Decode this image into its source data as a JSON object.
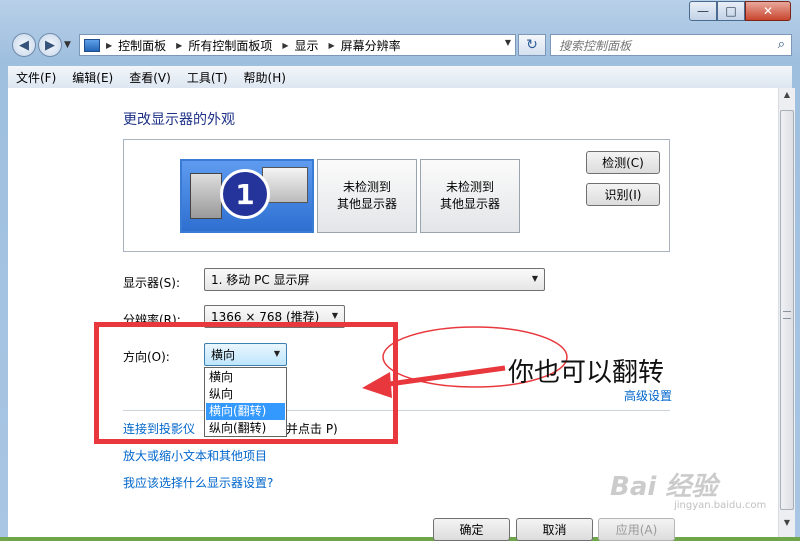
{
  "window": {
    "minimize_glyph": "—",
    "maximize_glyph": "□",
    "close_glyph": "✕"
  },
  "nav": {
    "back_glyph": "◀",
    "forward_glyph": "▶",
    "recent_glyph": "▼",
    "breadcrumbs": [
      "控制面板",
      "所有控制面板项",
      "显示",
      "屏幕分辨率"
    ],
    "refresh_glyph": "↻",
    "search_placeholder": "搜索控制面板",
    "search_glyph": "⌕"
  },
  "menu": [
    "文件(F)",
    "编辑(E)",
    "查看(V)",
    "工具(T)",
    "帮助(H)"
  ],
  "main": {
    "title": "更改显示器的外观",
    "monitors": [
      {
        "label": "1",
        "selected": true
      },
      {
        "label": "未检测到\n其他显示器"
      },
      {
        "label": "未检测到\n其他显示器"
      }
    ],
    "detect_button": "检测(C)",
    "identify_button": "识别(I)",
    "display_label": "显示器(S):",
    "display_value": "1. 移动 PC 显示屏",
    "resolution_label": "分辨率(R):",
    "resolution_value": "1366 × 768 (推荐)",
    "orientation_label": "方向(O):",
    "orientation_value": "横向",
    "orientation_options": [
      "横向",
      "纵向",
      "横向(翻转)",
      "纵向(翻转)"
    ],
    "orientation_highlighted": "横向(翻转)",
    "advanced_link": "高级设置",
    "projector_link": "连接到投影仪",
    "projector_hint": "并点击 P)",
    "text_size_link": "放大或缩小文本和其他项目",
    "which_settings_link": "我应该选择什么显示器设置?"
  },
  "footer": {
    "ok": "确定",
    "cancel": "取消",
    "apply": "应用(A)"
  },
  "annotation": {
    "text": "你也可以翻转"
  },
  "watermark": {
    "text": "Bai 经验",
    "sub": "jingyan.baidu.com"
  },
  "colors": {
    "link": "#0066cc",
    "title": "#1e3287",
    "annotation": "#e8383d",
    "selection": "#3399ff"
  }
}
